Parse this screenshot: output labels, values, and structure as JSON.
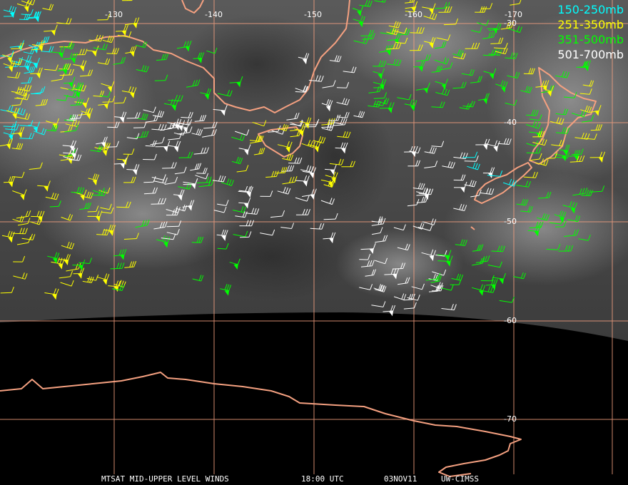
{
  "legend": [
    {
      "label": "150-250mb",
      "color": "#00ffff"
    },
    {
      "label": "251-350mb",
      "color": "#ffff00"
    },
    {
      "label": "351-500mb",
      "color": "#00ff00"
    },
    {
      "label": "501-700mb",
      "color": "#ffffff"
    }
  ],
  "lon_labels": [
    "-130",
    "-140",
    "-150",
    "-160",
    "-170"
  ],
  "lat_labels": [
    "-30",
    "-40",
    "-50",
    "-60",
    "-70"
  ],
  "footer": {
    "product": "MTSAT MID-UPPER LEVEL WINDS",
    "time": "18:00 UTC",
    "date": "03NOV11",
    "source": "UW-CIMSS"
  },
  "colors": {
    "coastline": "#f4a080",
    "grid": "#f4a080",
    "background": "#000000"
  }
}
